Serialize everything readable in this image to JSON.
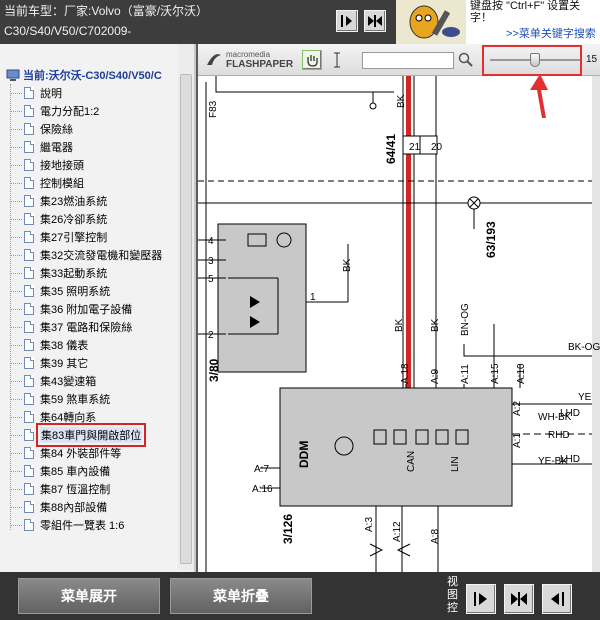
{
  "header": {
    "vehicle_label": "当前车型：",
    "vehicle_value": "厂家:Volvo（富豪/沃尔沃）",
    "vehicle_line2": "C30/S40/V50/C702009-",
    "help_line1": "键盘按 \"Ctrl+F\" 设置关",
    "help_line2": "字！",
    "help_link": ">>菜单关键字搜索"
  },
  "tree": {
    "root_label": "当前:沃尔沃-C30/S40/V50/C",
    "items": [
      {
        "label": "說明"
      },
      {
        "label": "電力分配1:2"
      },
      {
        "label": "保險絲"
      },
      {
        "label": "繼電器"
      },
      {
        "label": "接地接頭"
      },
      {
        "label": "控制模組"
      },
      {
        "label": "集23燃油系統"
      },
      {
        "label": "集26冷卻系統"
      },
      {
        "label": "集27引擎控制"
      },
      {
        "label": "集32交流發電機和變壓器"
      },
      {
        "label": "集33起動系統"
      },
      {
        "label": "集35 照明系統"
      },
      {
        "label": "集36 附加電子設備"
      },
      {
        "label": "集37 電路和保險絲"
      },
      {
        "label": "集38 儀表"
      },
      {
        "label": "集39 其它"
      },
      {
        "label": "集43變速箱"
      },
      {
        "label": "集59 煞車系統"
      },
      {
        "label": "集64轉向系"
      },
      {
        "label": "集83車門與開啟部位",
        "selected": true
      },
      {
        "label": "集84 外裝部件等"
      },
      {
        "label": "集85 車內設備"
      },
      {
        "label": "集87 恆溫控制"
      },
      {
        "label": "集88內部設備"
      },
      {
        "label": "零組件一覽表 1:6"
      }
    ]
  },
  "buttons": {
    "expand": "菜单展开",
    "collapse": "菜单折叠",
    "view_label": "视图控"
  },
  "player": {
    "brand_top": "macromedia",
    "brand_bottom": "FLASHPAPER",
    "zoom_value": "15"
  },
  "diagram": {
    "labels": {
      "f83": "F83",
      "bk": "BK",
      "fuse": "64/41",
      "pin21": "21",
      "pin20": "20",
      "ground": "63/193",
      "pin4": "4",
      "pin3": "3",
      "pin5": "5",
      "pin1": "1",
      "pin2": "2",
      "relay": "3/80",
      "bk1": "BK",
      "bk2": "BK",
      "bk3": "BK",
      "bnog": "BN-OG",
      "bkog": "BK-OG",
      "a18": "A:18",
      "a9": "A:9",
      "a11": "A:11",
      "a15": "A:15",
      "a10": "A:10",
      "ye": "YE",
      "a2": "A:2",
      "wh_bk": "WH-BK",
      "lhd1": "LHD",
      "a1": "A:1",
      "rhd": "RHD",
      "ye_bk": "YE-BK",
      "lhd2": "LHD",
      "ddm": "DDM",
      "can": "CAN",
      "lin": "LIN",
      "a7": "A:7",
      "a16": "A:16",
      "m126": "3/126",
      "a3": "A:3",
      "a12": "A:12",
      "a8": "A:8"
    }
  },
  "colors": {
    "red_wire": "#d42525",
    "highlight": "#d42525",
    "module_fill": "#c8c8c8"
  }
}
